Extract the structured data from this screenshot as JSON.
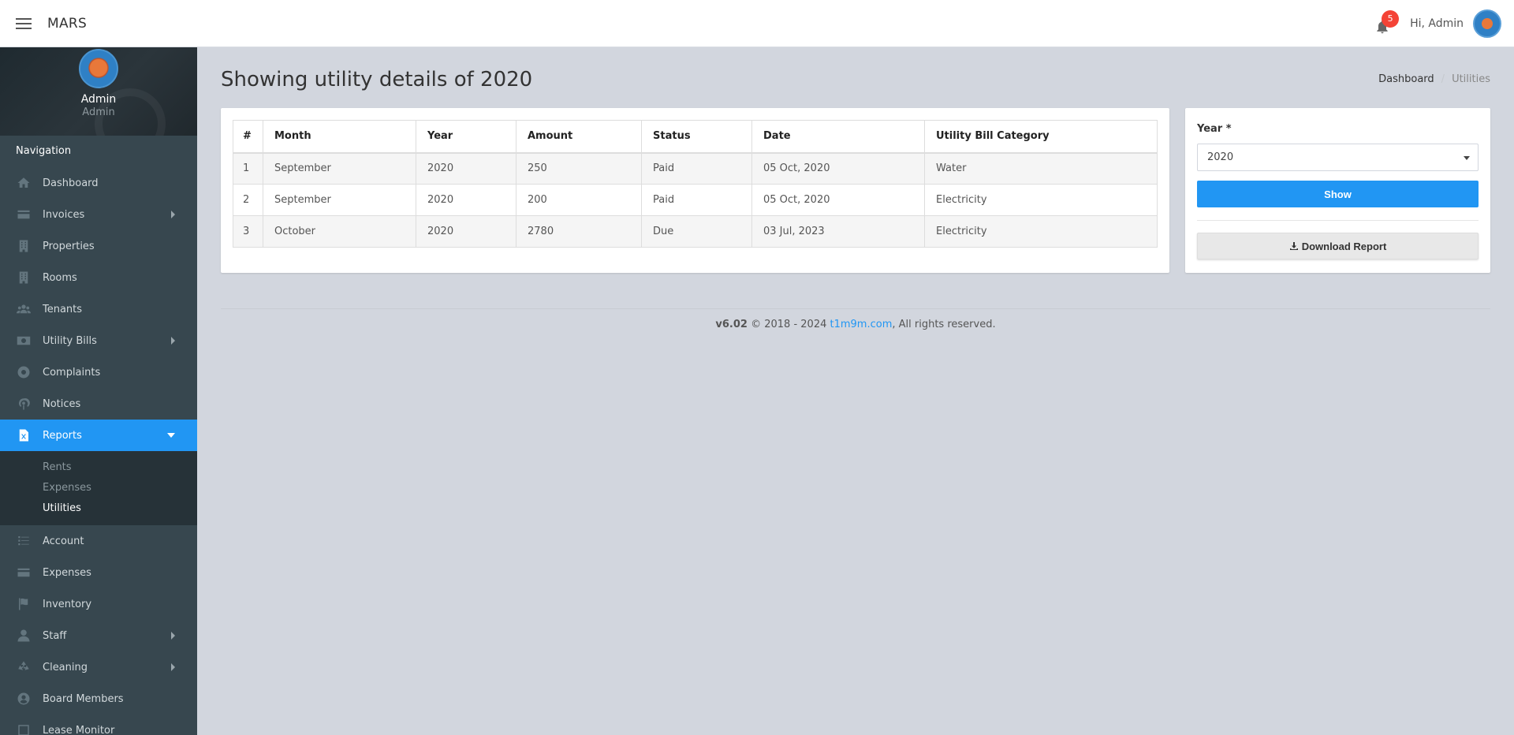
{
  "topbar": {
    "app_name": "MARS",
    "notification_count": "5",
    "greeting": "Hi, Admin"
  },
  "profile": {
    "name": "Admin",
    "role": "Admin"
  },
  "nav": {
    "header": "Navigation",
    "items": [
      {
        "label": "Dashboard",
        "icon": "home-icon"
      },
      {
        "label": "Invoices",
        "icon": "credit-card-icon"
      },
      {
        "label": "Properties",
        "icon": "building-icon"
      },
      {
        "label": "Rooms",
        "icon": "building-icon"
      },
      {
        "label": "Tenants",
        "icon": "users-icon"
      },
      {
        "label": "Utility Bills",
        "icon": "money-bill-icon"
      },
      {
        "label": "Complaints",
        "icon": "life-ring-icon"
      },
      {
        "label": "Notices",
        "icon": "podcast-icon"
      },
      {
        "label": "Reports",
        "icon": "file-excel-icon"
      },
      {
        "label": "Account",
        "icon": "list-icon"
      },
      {
        "label": "Expenses",
        "icon": "credit-card-icon"
      },
      {
        "label": "Inventory",
        "icon": "flag-icon"
      },
      {
        "label": "Staff",
        "icon": "user-icon"
      },
      {
        "label": "Cleaning",
        "icon": "recycle-icon"
      },
      {
        "label": "Board Members",
        "icon": "user-circle-icon"
      },
      {
        "label": "Lease Monitor",
        "icon": "square-icon"
      }
    ],
    "reports_submenu": [
      "Rents",
      "Expenses",
      "Utilities"
    ]
  },
  "page": {
    "title": "Showing utility details of 2020",
    "breadcrumb": [
      "Dashboard",
      "Utilities"
    ]
  },
  "table": {
    "headers": [
      "#",
      "Month",
      "Year",
      "Amount",
      "Status",
      "Date",
      "Utility Bill Category"
    ],
    "rows": [
      [
        "1",
        "September",
        "2020",
        "250",
        "Paid",
        "05 Oct, 2020",
        "Water"
      ],
      [
        "2",
        "September",
        "2020",
        "200",
        "Paid",
        "05 Oct, 2020",
        "Electricity"
      ],
      [
        "3",
        "October",
        "2020",
        "2780",
        "Due",
        "03 Jul, 2023",
        "Electricity"
      ]
    ]
  },
  "form": {
    "year_label": "Year *",
    "year_value": "2020",
    "show_label": "Show",
    "download_label": "Download Report"
  },
  "footer": {
    "version": "v6.02",
    "copyright": " © 2018 - 2024 ",
    "link_text": "t1m9m.com",
    "rights": ", All rights reserved."
  },
  "colors": {
    "primary": "#2196f3",
    "sidebar": "#37474f",
    "sidebar_sub": "#263238",
    "page_bg": "#d2d6de",
    "badge": "#f44336"
  }
}
